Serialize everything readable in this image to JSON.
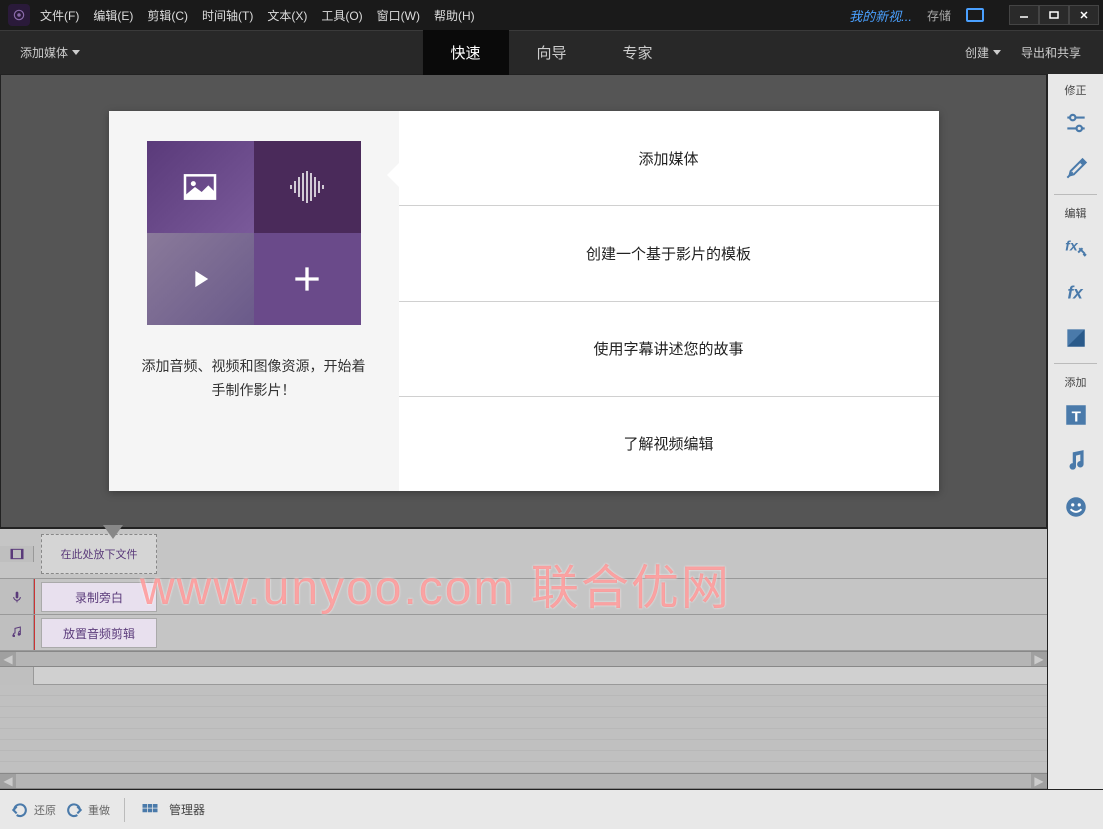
{
  "menubar": {
    "items": [
      "文件(F)",
      "编辑(E)",
      "剪辑(C)",
      "时间轴(T)",
      "文本(X)",
      "工具(O)",
      "窗口(W)",
      "帮助(H)"
    ]
  },
  "titlebar": {
    "project_name": "我的新视...",
    "save_label": "存储"
  },
  "toolbar": {
    "add_media": "添加媒体",
    "tabs": [
      "快速",
      "向导",
      "专家"
    ],
    "create": "创建",
    "export": "导出和共享"
  },
  "welcome": {
    "description": "添加音频、视频和图像资源，开始着手制作影片！",
    "options": [
      "添加媒体",
      "创建一个基于影片的模板",
      "使用字幕讲述您的故事",
      "了解视频编辑"
    ]
  },
  "timeline": {
    "drop_hint": "在此处放下文件",
    "narration": "录制旁白",
    "audio_clip": "放置音频剪辑"
  },
  "sidebar": {
    "section_fix": "修正",
    "section_edit": "编辑",
    "section_add": "添加"
  },
  "bottombar": {
    "undo": "还原",
    "redo": "重做",
    "organizer": "管理器"
  },
  "watermark": "www.unyoo.com 联合优网"
}
